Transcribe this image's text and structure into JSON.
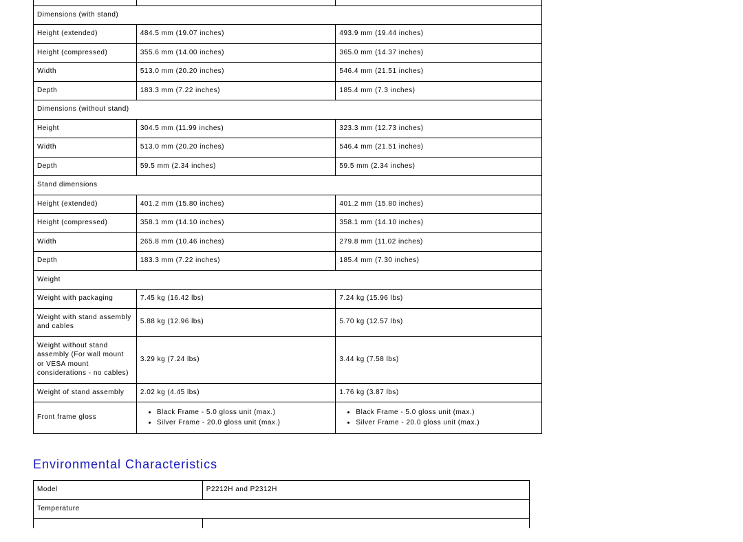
{
  "table1": {
    "sections": {
      "s1": "Dimensions (with stand)",
      "s2": "Dimensions (without stand)",
      "s3": "Stand dimensions",
      "s4": "Weight"
    },
    "rows": {
      "r1": {
        "a": "Height (extended)",
        "b": "484.5 mm (19.07 inches)",
        "c": "493.9 mm (19.44 inches)"
      },
      "r2": {
        "a": "Height (compressed)",
        "b": "355.6 mm (14.00 inches)",
        "c": "365.0 mm (14.37 inches)"
      },
      "r3": {
        "a": "Width",
        "b": "513.0 mm (20.20 inches)",
        "c": "546.4 mm (21.51 inches)"
      },
      "r4": {
        "a": "Depth",
        "b": "183.3 mm (7.22 inches)",
        "c": "185.4 mm (7.3 inches)"
      },
      "r5": {
        "a": "Height",
        "b": "304.5 mm (11.99 inches)",
        "c": "323.3 mm (12.73 inches)"
      },
      "r6": {
        "a": "Width",
        "b": "513.0 mm (20.20 inches)",
        "c": "546.4 mm (21.51 inches)"
      },
      "r7": {
        "a": "Depth",
        "b": "59.5 mm (2.34 inches)",
        "c": "59.5 mm (2.34 inches)"
      },
      "r8": {
        "a": "Height (extended)",
        "b": "401.2 mm (15.80 inches)",
        "c": "401.2 mm (15.80 inches)"
      },
      "r9": {
        "a": "Height (compressed)",
        "b": "358.1 mm (14.10 inches)",
        "c": "358.1 mm (14.10 inches)"
      },
      "r10": {
        "a": "Width",
        "b": "265.8 mm (10.46 inches)",
        "c": "279.8 mm (11.02 inches)"
      },
      "r11": {
        "a": "Depth",
        "b": "183.3 mm (7.22 inches)",
        "c": "185.4 mm (7.30 inches)"
      },
      "r12": {
        "a": "Weight with packaging",
        "b": "7.45 kg (16.42 lbs)",
        "c": "7.24 kg (15.96 lbs)"
      },
      "r13": {
        "a": "Weight with stand assembly and cables",
        "b": "5.88 kg (12.96 lbs)",
        "c": "5.70 kg (12.57 lbs)"
      },
      "r14": {
        "a": "Weight without stand assembly\n(For wall mount or VESA mount considerations - no cables)",
        "b": "3.29 kg (7.24 lbs)",
        "c": "3.44 kg (7.58 lbs)"
      },
      "r15": {
        "a": "Weight of stand assembly",
        "b": "2.02 kg (4.45 lbs)",
        "c": "1.76 kg (3.87 lbs)"
      },
      "r16": {
        "a": "Front frame gloss",
        "b1": "Black Frame - 5.0 gloss unit (max.)",
        "b2": "Silver Frame - 20.0 gloss unit (max.)",
        "c1": "Black Frame - 5.0 gloss unit (max.)",
        "c2": "Silver Frame - 20.0 gloss unit (max.)"
      }
    }
  },
  "env": {
    "heading": "Environmental Characteristics",
    "rows": {
      "r1": {
        "a": "Model",
        "b": "P2212H and P2312H"
      },
      "s1": "Temperature"
    }
  }
}
